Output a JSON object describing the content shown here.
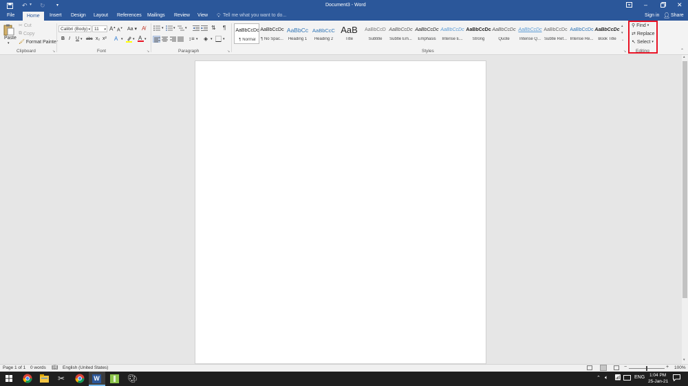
{
  "titlebar": {
    "title": "Document3 - Word",
    "icons": {
      "save": "save-icon",
      "undo": "undo-icon",
      "redo": "redo-icon",
      "customize": "customize-icon"
    },
    "window_controls": [
      "ribbon-display-icon",
      "minimize-icon",
      "restore-icon",
      "close-icon"
    ]
  },
  "tabs": {
    "items": [
      "File",
      "Home",
      "Insert",
      "Design",
      "Layout",
      "References",
      "Mailings",
      "Review",
      "View"
    ],
    "active": "Home",
    "tell_me": "Tell me what you want to do...",
    "sign_in": "Sign in",
    "share": "Share"
  },
  "clipboard": {
    "paste": "Paste",
    "cut": "Cut",
    "copy": "Copy",
    "format_painter": "Format Painter",
    "label": "Clipboard"
  },
  "font": {
    "family": "Calibri (Body)",
    "size": "11",
    "label": "Font",
    "bold": "B",
    "italic": "I",
    "underline": "U",
    "strike": "abc",
    "sub": "x₂",
    "sup": "x²",
    "grow": "A",
    "shrink": "A",
    "case": "Aa"
  },
  "paragraph": {
    "label": "Paragraph",
    "show_marks": "¶"
  },
  "styles": {
    "label": "Styles",
    "items": [
      {
        "sample": "AaBbCcDc",
        "name": "¶ Normal"
      },
      {
        "sample": "AaBbCcDc",
        "name": "¶ No Spac..."
      },
      {
        "sample": "AaBbCc",
        "name": "Heading 1"
      },
      {
        "sample": "AaBbCcC",
        "name": "Heading 2"
      },
      {
        "sample": "AaB",
        "name": "Title"
      },
      {
        "sample": "AaBbCcD",
        "name": "Subtitle"
      },
      {
        "sample": "AaBbCcDc",
        "name": "Subtle Em..."
      },
      {
        "sample": "AaBbCcDc",
        "name": "Emphasis"
      },
      {
        "sample": "AaBbCcDc",
        "name": "Intense E..."
      },
      {
        "sample": "AaBbCcDc",
        "name": "Strong"
      },
      {
        "sample": "AaBbCcDc",
        "name": "Quote"
      },
      {
        "sample": "AaBbCcDc",
        "name": "Intense Q..."
      },
      {
        "sample": "AaBbCcDc",
        "name": "Subtle Ref..."
      },
      {
        "sample": "AaBbCcDc",
        "name": "Intense Re..."
      },
      {
        "sample": "AaBbCcDc",
        "name": "Book Title"
      }
    ]
  },
  "editing": {
    "find": "Find",
    "replace": "Replace",
    "select": "Select",
    "label": "Editing"
  },
  "status": {
    "page": "Page 1 of 1",
    "words": "0 words",
    "language": "English (United States)",
    "zoom": "100%"
  },
  "taskbar": {
    "lang": "ENG",
    "time": "1:04 PM",
    "date": "25-Jan-21"
  },
  "colors": {
    "word_blue": "#2b579a",
    "highlight_red": "#e81123"
  }
}
